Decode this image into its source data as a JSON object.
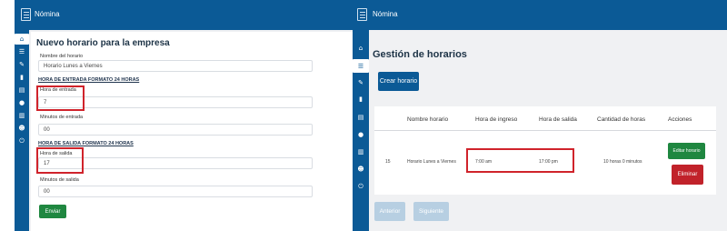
{
  "app": {
    "title": "Nómina",
    "logo_text": "NOMINA"
  },
  "colors": {
    "primary": "#0b5a96",
    "success": "#1f8740",
    "danger": "#c1222a",
    "highlight": "#d0232b"
  },
  "sidebar_icons": [
    "home-icon",
    "schedule-icon",
    "pencil-icon",
    "clipboard-icon",
    "document-icon",
    "circle-icon",
    "file-icon",
    "user-icon",
    "power-icon"
  ],
  "form": {
    "title": "Nuevo horario para la empresa",
    "name_label": "Nombre del horario",
    "name_value": "Horario Lunes a Viernes",
    "entry_section": "HORA DE ENTRADA FORMATO 24 HORAS",
    "entry_hour_label": "Hora de entrada",
    "entry_hour_value": "7",
    "entry_min_label": "Minutos de entrada",
    "entry_min_value": "00",
    "exit_section": "HORA DE SALIDA FORMATO 24 HORAS",
    "exit_hour_label": "Hora de salida",
    "exit_hour_value": "17",
    "exit_min_label": "Minutos de salida",
    "exit_min_value": "00",
    "submit_label": "Enviar"
  },
  "manager": {
    "title": "Gestión de horarios",
    "create_label": "Crear horario",
    "columns": [
      "Nombre horario",
      "Hora de ingreso",
      "Hora de salida",
      "Cantidad de horas",
      "Acciones"
    ],
    "row": {
      "id": "15",
      "name": "Horario Lunes a Viernes",
      "entry": "7:00 am",
      "exit": "17:00 pm",
      "hours": "10 horas 0 minutos",
      "edit_label": "Editar horario",
      "delete_label": "Eliminar"
    },
    "prev_label": "Anterior",
    "next_label": "Siguiente"
  }
}
